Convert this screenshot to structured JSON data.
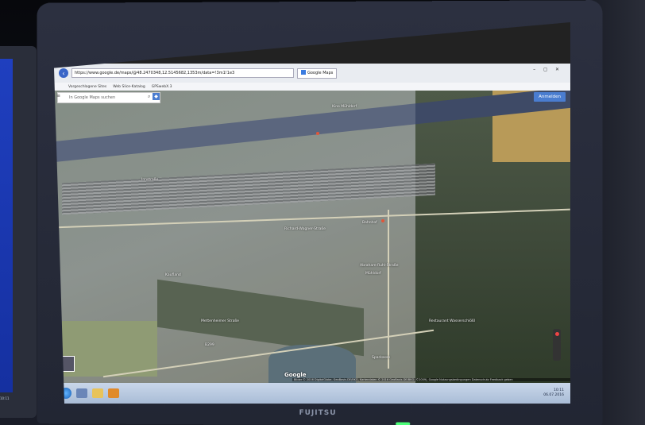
{
  "left_monitor": {
    "clock": "10:11"
  },
  "browser": {
    "url": "https://www.google.de/maps/@48.2470348,12.5145682,1353m/data=!3m1!1e3",
    "tab_title": "Google Maps",
    "favorites": [
      "Vorgeschlagene Sites",
      "Web Slice-Katalog",
      "GPSwebX.3"
    ],
    "window_controls": "– ◻ ✕"
  },
  "map": {
    "search_placeholder": "In Google Maps suchen",
    "signin_label": "Anmelden",
    "logo": "Google",
    "attribution": "Bilder © 2016 DigitalGlobe, GeoBasis-DE/BKG, Kartendaten © 2016 GeoBasis-DE/BKG (©2009), Google   Nutzungsbedingungen   Datenschutz   Feedback geben",
    "labels": {
      "kno_muhldorf": "Kino Mühldorf",
      "richard_wagner": "Richard-Wagner-Straße",
      "bahnhof": "Bahnhof",
      "abraham_ruhl": "Abraham-Ruhl-Straße",
      "muhldorf": "Mühldorf",
      "restaurant": "Restaurant Wasserschlößl",
      "kaufland": "Kaufland",
      "innstrasse": "Innstraße",
      "b299": "B299",
      "mettenheimer": "Mettenheimer Straße",
      "sparkasse": "Sparkasse"
    }
  },
  "taskbar": {
    "time": "10:11",
    "date": "06.07.2016"
  }
}
